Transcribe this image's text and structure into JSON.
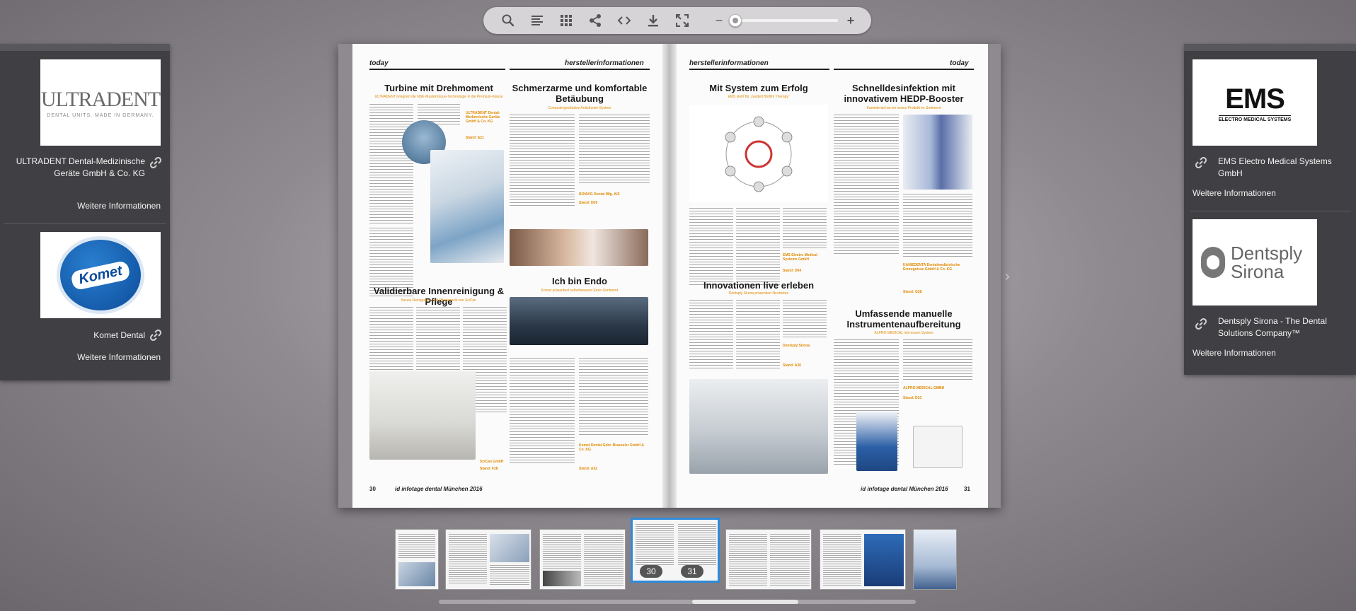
{
  "toolbar": {
    "icons": [
      "search-icon",
      "toc-icon",
      "grid-icon",
      "share-icon",
      "embed-icon",
      "download-icon",
      "fullscreen-icon"
    ],
    "zoom_minus": "−",
    "zoom_plus": "+",
    "zoom_level": 0.0
  },
  "left_panel": {
    "sponsors": [
      {
        "logo_text": "ULTRADENT",
        "logo_sub": "DENTAL UNITS. MADE IN GERMANY.",
        "name": "ULTRADENT Dental-Medizinische Geräte GmbH & Co. KG",
        "more": "Weitere Informationen"
      },
      {
        "logo_text": "Komet",
        "logo_sub": "",
        "name": "Komet Dental",
        "more": "Weitere Informationen"
      }
    ]
  },
  "right_panel": {
    "sponsors": [
      {
        "logo_text": "EMS",
        "logo_sub": "ELECTRO MEDICAL SYSTEMS",
        "name": "EMS Electro Medical Systems GmbH",
        "more": "Weitere Informationen"
      },
      {
        "logo_text": "Dentsply Sirona",
        "logo_sub": "",
        "name": "Dentsply Sirona - The Dental Solutions Company™",
        "more": "Weitere Informationen"
      }
    ]
  },
  "spread": {
    "left": {
      "brand": "today",
      "section": "herstellerinformationen",
      "articles": [
        {
          "title": "Turbine mit Drehmoment",
          "sub": "ULTRADENT integriert die NSK-Mastertorque-Technologie in die Premium-Klasse"
        },
        {
          "title": "Schmerzarme und komfortable Betäubung",
          "sub": "Computergestütztes Anästhesie-System"
        },
        {
          "title": "Validierbare Innenreinigung & Pflege",
          "sub": "Neues Reinigungs- und Pflegegerät von SciCan"
        },
        {
          "title": "Ich bin Endo",
          "sub": "Komet präsentiert selbstbewusst Endo-Sortiment"
        }
      ],
      "contacts": [
        "ULTRADENT Dental-Medizinische Geräte GmbH & Co. KG",
        "Stand: E21",
        "RONVIG Dental Mfg. A/S",
        "Stand: D09",
        "SciCan GmbH",
        "Stand: F28",
        "Komet Dental Gebr. Brasseler GmbH & Co. KG",
        "Stand: A32"
      ],
      "footer_num": "30",
      "footer_text": "id infotage dental München 2016"
    },
    "right": {
      "brand": "today",
      "section": "herstellerinformationen",
      "articles": [
        {
          "title": "Mit System zum Erfolg",
          "sub": "EMS steht für „Guided Biofilm Therapy“"
        },
        {
          "title": "Schnelldesinfektion mit innovativem HEDP-Booster",
          "sub": "Kaniedenta hat ein neues Produkt im Sortiment"
        },
        {
          "title": "Innovationen live erleben",
          "sub": "Dentsply Sirona präsentiert Neuheiten"
        },
        {
          "title": "Umfassende manuelle Instrumentenaufbereitung",
          "sub": "ALPRO MEDICAL mit neuem System"
        }
      ],
      "contacts": [
        "EMS Electro Medical Systems GmbH",
        "Stand: D04",
        "Dentsply Sirona",
        "Stand: A30",
        "KANIEDENTA Dentalmedizinische Erzeugnisse GmbH & Co. KG",
        "Stand: G28",
        "ALPRO MEDICAL GMBH",
        "Stand: D10"
      ],
      "footer_num": "31",
      "footer_text": "id infotage dental München 2016"
    }
  },
  "thumbnails": {
    "active_pages": [
      "30",
      "31"
    ]
  },
  "colors": {
    "accent_blue": "#2f8ad8",
    "panel_bg": "#403f43",
    "orange_text": "#e08a00"
  }
}
